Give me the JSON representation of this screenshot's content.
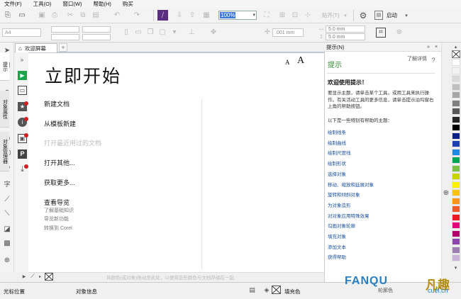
{
  "menu": [
    "文件(F)",
    "工具(O)",
    "窗口(W)",
    "帮助(H)",
    "购买"
  ],
  "toolbar": {
    "zoom": "100%",
    "snap_label": "贴齐(T)",
    "launch_label": "启动",
    "nudge": ".001 mm",
    "dup_x": "5.0 mm",
    "dup_y": "5.0 mm",
    "page_size": "A4"
  },
  "tab": {
    "label": "欢迎屏幕"
  },
  "welcome": {
    "title": "立即开始",
    "font_small": "A",
    "font_large": "A",
    "links": [
      "新建文档",
      "从模板新建",
      "打开最近用过的文档",
      "打开其他...",
      "获取更多..."
    ],
    "guide_title": "查看导览",
    "guide_links": [
      "了解基础知识",
      "导览新功能",
      "转换到 Corel"
    ],
    "drop_hint": "将颜色(或对象)拖动至此处，以便将这些颜色与文档存储在一起"
  },
  "hints_panel": {
    "header": "提示(N)",
    "title": "提示",
    "more_link": "了解详情",
    "welcome_heading": "欢迎使用提示！",
    "intro": "要显示主题，请单击某个工具，或用工具来执行操作。有关活动工具的更多信息，请单击提示泊坞窗右上角的帮助按钮。",
    "list_intro": "以下是一些特别有帮助的主题：",
    "topics": [
      "绘制线条",
      "绘制曲线",
      "绘制尺度线",
      "绘制形状",
      "选择对象",
      "移动、缩放和延展对象",
      "旋转和倾斜对象",
      "为对象造形",
      "对对象应用特殊效果",
      "勾画对象轮廓",
      "填充对象",
      "添加文本",
      "获得帮助"
    ]
  },
  "side_tabs": [
    "提示",
    "对象属性",
    "对象管理器"
  ],
  "palette_colors": [
    "#ffffff",
    "#f2f2f2",
    "#d9d9d9",
    "#bfbfbf",
    "#a6a6a6",
    "#808080",
    "#595959",
    "#262626",
    "#000000",
    "#0b1f8a",
    "#1c3fb4",
    "#1e88e5",
    "#00a651",
    "#7ac143",
    "#c8d400",
    "#fff200",
    "#ffc20e",
    "#f7941d",
    "#f15a24",
    "#ed1c24",
    "#e6007e",
    "#b3006c",
    "#8e44ad",
    "#9e7fb5",
    "#c9b4d8"
  ],
  "status": {
    "cursor": "光标位置",
    "object_info": "对象信息",
    "fill": "填充色",
    "outline": "轮廓色"
  },
  "watermark": {
    "brand": "FANQU",
    "cn": "凡趣",
    "domain": "cuel.cn"
  }
}
